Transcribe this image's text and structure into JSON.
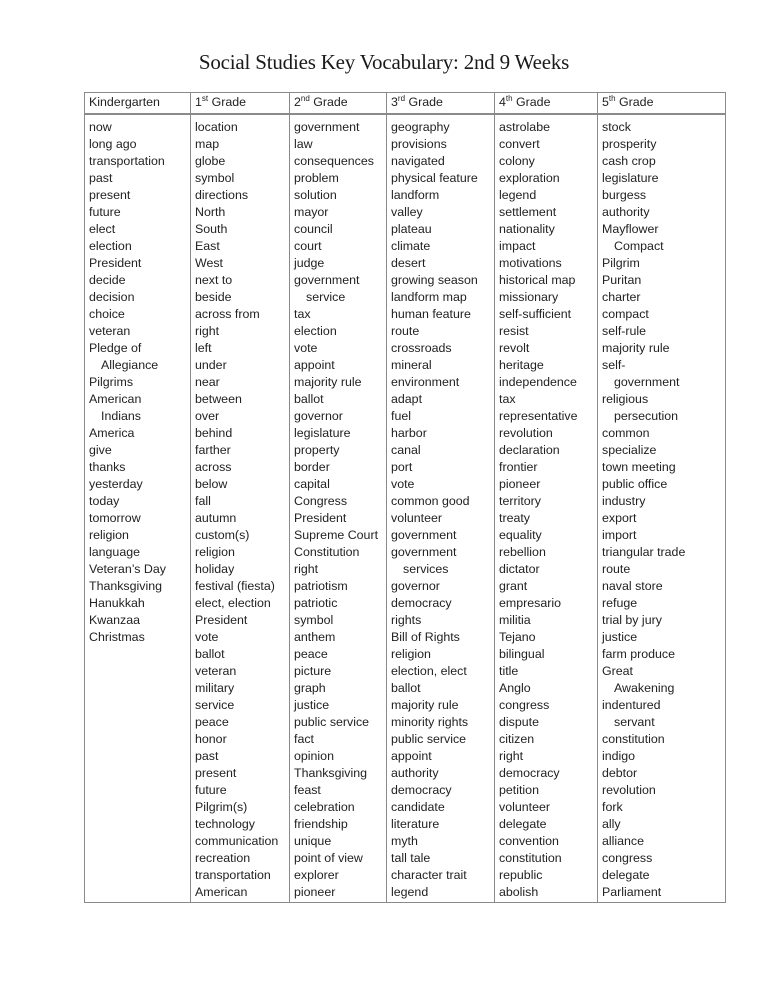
{
  "document": {
    "title": "Social Studies Key Vocabulary: 2nd 9 Weeks"
  },
  "table": {
    "columns": [
      {
        "header_num": "",
        "header_sup": "",
        "header_text": "Kindergarten",
        "words": [
          {
            "t": "now"
          },
          {
            "t": "long ago"
          },
          {
            "t": "transportation"
          },
          {
            "t": "past"
          },
          {
            "t": "present"
          },
          {
            "t": "future"
          },
          {
            "t": "elect"
          },
          {
            "t": "election"
          },
          {
            "t": "President"
          },
          {
            "t": "decide"
          },
          {
            "t": "decision"
          },
          {
            "t": "choice"
          },
          {
            "t": "veteran"
          },
          {
            "t": "Pledge of"
          },
          {
            "t": "Allegiance",
            "indent": true
          },
          {
            "t": "Pilgrims"
          },
          {
            "t": "American"
          },
          {
            "t": "Indians",
            "indent": true
          },
          {
            "t": "America"
          },
          {
            "t": "give"
          },
          {
            "t": "thanks"
          },
          {
            "t": "yesterday"
          },
          {
            "t": "today"
          },
          {
            "t": "tomorrow"
          },
          {
            "t": "religion"
          },
          {
            "t": "language"
          },
          {
            "t": "Veteran’s Day"
          },
          {
            "t": "Thanksgiving"
          },
          {
            "t": "Hanukkah"
          },
          {
            "t": "Kwanzaa"
          },
          {
            "t": "Christmas"
          }
        ]
      },
      {
        "header_num": "1",
        "header_sup": "st",
        "header_text": " Grade",
        "words": [
          {
            "t": "location"
          },
          {
            "t": "map"
          },
          {
            "t": "globe"
          },
          {
            "t": "symbol"
          },
          {
            "t": "directions"
          },
          {
            "t": "North"
          },
          {
            "t": "South"
          },
          {
            "t": "East"
          },
          {
            "t": "West"
          },
          {
            "t": "next to"
          },
          {
            "t": "beside"
          },
          {
            "t": "across from"
          },
          {
            "t": "right"
          },
          {
            "t": "left"
          },
          {
            "t": "under"
          },
          {
            "t": "near"
          },
          {
            "t": "between"
          },
          {
            "t": "over"
          },
          {
            "t": "behind"
          },
          {
            "t": "farther"
          },
          {
            "t": "across"
          },
          {
            "t": "below"
          },
          {
            "t": "fall"
          },
          {
            "t": "autumn"
          },
          {
            "t": "custom(s)"
          },
          {
            "t": "religion"
          },
          {
            "t": "holiday"
          },
          {
            "t": "festival (fiesta)"
          },
          {
            "t": "elect, election"
          },
          {
            "t": "President"
          },
          {
            "t": "vote"
          },
          {
            "t": "ballot"
          },
          {
            "t": "veteran"
          },
          {
            "t": "military"
          },
          {
            "t": "service"
          },
          {
            "t": "peace"
          },
          {
            "t": "honor"
          },
          {
            "t": "past"
          },
          {
            "t": "present"
          },
          {
            "t": "future"
          },
          {
            "t": "Pilgrim(s)"
          },
          {
            "t": "technology"
          },
          {
            "t": "communication"
          },
          {
            "t": "recreation"
          },
          {
            "t": "transportation"
          },
          {
            "t": "American"
          }
        ]
      },
      {
        "header_num": "2",
        "header_sup": "nd",
        "header_text": " Grade",
        "words": [
          {
            "t": "government"
          },
          {
            "t": "law"
          },
          {
            "t": "consequences"
          },
          {
            "t": "problem"
          },
          {
            "t": "solution"
          },
          {
            "t": "mayor"
          },
          {
            "t": "council"
          },
          {
            "t": "court"
          },
          {
            "t": "judge"
          },
          {
            "t": "government"
          },
          {
            "t": "service",
            "indent": true
          },
          {
            "t": "tax"
          },
          {
            "t": "election"
          },
          {
            "t": "vote"
          },
          {
            "t": "appoint"
          },
          {
            "t": "majority rule"
          },
          {
            "t": "ballot"
          },
          {
            "t": "governor"
          },
          {
            "t": "legislature"
          },
          {
            "t": "property"
          },
          {
            "t": "border"
          },
          {
            "t": "capital"
          },
          {
            "t": "Congress"
          },
          {
            "t": "President"
          },
          {
            "t": "Supreme Court"
          },
          {
            "t": "Constitution"
          },
          {
            "t": "right"
          },
          {
            "t": "patriotism"
          },
          {
            "t": "patriotic"
          },
          {
            "t": "symbol"
          },
          {
            "t": "anthem"
          },
          {
            "t": "peace"
          },
          {
            "t": "picture"
          },
          {
            "t": "graph"
          },
          {
            "t": "justice"
          },
          {
            "t": "public service"
          },
          {
            "t": "fact"
          },
          {
            "t": "opinion"
          },
          {
            "t": "Thanksgiving"
          },
          {
            "t": "feast"
          },
          {
            "t": "celebration"
          },
          {
            "t": "friendship"
          },
          {
            "t": "unique"
          },
          {
            "t": "point of view"
          },
          {
            "t": "explorer"
          },
          {
            "t": "pioneer"
          }
        ]
      },
      {
        "header_num": "3",
        "header_sup": "rd",
        "header_text": " Grade",
        "words": [
          {
            "t": "geography"
          },
          {
            "t": "provisions"
          },
          {
            "t": "navigated"
          },
          {
            "t": "physical feature"
          },
          {
            "t": "landform"
          },
          {
            "t": "valley"
          },
          {
            "t": "plateau"
          },
          {
            "t": "climate"
          },
          {
            "t": "desert"
          },
          {
            "t": "growing season"
          },
          {
            "t": "landform map"
          },
          {
            "t": "human feature"
          },
          {
            "t": "route"
          },
          {
            "t": "crossroads"
          },
          {
            "t": "mineral"
          },
          {
            "t": "environment"
          },
          {
            "t": "adapt"
          },
          {
            "t": "fuel"
          },
          {
            "t": "harbor"
          },
          {
            "t": "canal"
          },
          {
            "t": "port"
          },
          {
            "t": "vote"
          },
          {
            "t": "common good"
          },
          {
            "t": "volunteer"
          },
          {
            "t": "government"
          },
          {
            "t": "government"
          },
          {
            "t": "services",
            "indent": true
          },
          {
            "t": "governor"
          },
          {
            "t": "democracy"
          },
          {
            "t": "rights"
          },
          {
            "t": "Bill of Rights"
          },
          {
            "t": "religion"
          },
          {
            "t": "election, elect"
          },
          {
            "t": "ballot"
          },
          {
            "t": "majority rule"
          },
          {
            "t": "minority rights"
          },
          {
            "t": "public service"
          },
          {
            "t": "appoint"
          },
          {
            "t": "authority"
          },
          {
            "t": "democracy"
          },
          {
            "t": "candidate"
          },
          {
            "t": "literature"
          },
          {
            "t": "myth"
          },
          {
            "t": "tall tale"
          },
          {
            "t": "character trait"
          },
          {
            "t": "legend"
          }
        ]
      },
      {
        "header_num": "4",
        "header_sup": "th",
        "header_text": " Grade",
        "words": [
          {
            "t": "astrolabe"
          },
          {
            "t": "convert"
          },
          {
            "t": "colony"
          },
          {
            "t": "exploration"
          },
          {
            "t": "legend"
          },
          {
            "t": "settlement"
          },
          {
            "t": "nationality"
          },
          {
            "t": "impact"
          },
          {
            "t": "motivations"
          },
          {
            "t": "historical map"
          },
          {
            "t": "missionary"
          },
          {
            "t": "self-sufficient"
          },
          {
            "t": "resist"
          },
          {
            "t": "revolt"
          },
          {
            "t": "heritage"
          },
          {
            "t": "independence"
          },
          {
            "t": "tax"
          },
          {
            "t": "representative"
          },
          {
            "t": "revolution"
          },
          {
            "t": "declaration"
          },
          {
            "t": "frontier"
          },
          {
            "t": "pioneer"
          },
          {
            "t": "territory"
          },
          {
            "t": "treaty"
          },
          {
            "t": "equality"
          },
          {
            "t": "rebellion"
          },
          {
            "t": "dictator"
          },
          {
            "t": "grant"
          },
          {
            "t": "empresario"
          },
          {
            "t": "militia"
          },
          {
            "t": "Tejano"
          },
          {
            "t": "bilingual"
          },
          {
            "t": "title"
          },
          {
            "t": "Anglo"
          },
          {
            "t": "congress"
          },
          {
            "t": "dispute"
          },
          {
            "t": "citizen"
          },
          {
            "t": "right"
          },
          {
            "t": "democracy"
          },
          {
            "t": "petition"
          },
          {
            "t": "volunteer"
          },
          {
            "t": "delegate"
          },
          {
            "t": "convention"
          },
          {
            "t": "constitution"
          },
          {
            "t": "republic"
          },
          {
            "t": "abolish"
          }
        ]
      },
      {
        "header_num": "5",
        "header_sup": "th",
        "header_text": " Grade",
        "words": [
          {
            "t": "stock"
          },
          {
            "t": "prosperity"
          },
          {
            "t": "cash crop"
          },
          {
            "t": "legislature"
          },
          {
            "t": "burgess"
          },
          {
            "t": "authority"
          },
          {
            "t": "Mayflower"
          },
          {
            "t": "Compact",
            "indent": true
          },
          {
            "t": "Pilgrim"
          },
          {
            "t": "Puritan"
          },
          {
            "t": "charter"
          },
          {
            "t": "compact"
          },
          {
            "t": "self-rule"
          },
          {
            "t": "majority rule"
          },
          {
            "t": "self-"
          },
          {
            "t": "government",
            "indent": true
          },
          {
            "t": "religious"
          },
          {
            "t": "persecution",
            "indent": true
          },
          {
            "t": "common"
          },
          {
            "t": "specialize"
          },
          {
            "t": "town meeting"
          },
          {
            "t": "public office"
          },
          {
            "t": "industry"
          },
          {
            "t": "export"
          },
          {
            "t": "import"
          },
          {
            "t": "triangular trade"
          },
          {
            "t": "route"
          },
          {
            "t": "naval store"
          },
          {
            "t": "refuge"
          },
          {
            "t": "trial by jury"
          },
          {
            "t": "justice"
          },
          {
            "t": "farm produce"
          },
          {
            "t": "Great"
          },
          {
            "t": "Awakening",
            "indent": true
          },
          {
            "t": "indentured"
          },
          {
            "t": "servant",
            "indent": true
          },
          {
            "t": "constitution"
          },
          {
            "t": "indigo"
          },
          {
            "t": "debtor"
          },
          {
            "t": "revolution"
          },
          {
            "t": "fork"
          },
          {
            "t": "ally"
          },
          {
            "t": "alliance"
          },
          {
            "t": "congress"
          },
          {
            "t": "delegate"
          },
          {
            "t": "Parliament"
          }
        ]
      }
    ]
  }
}
